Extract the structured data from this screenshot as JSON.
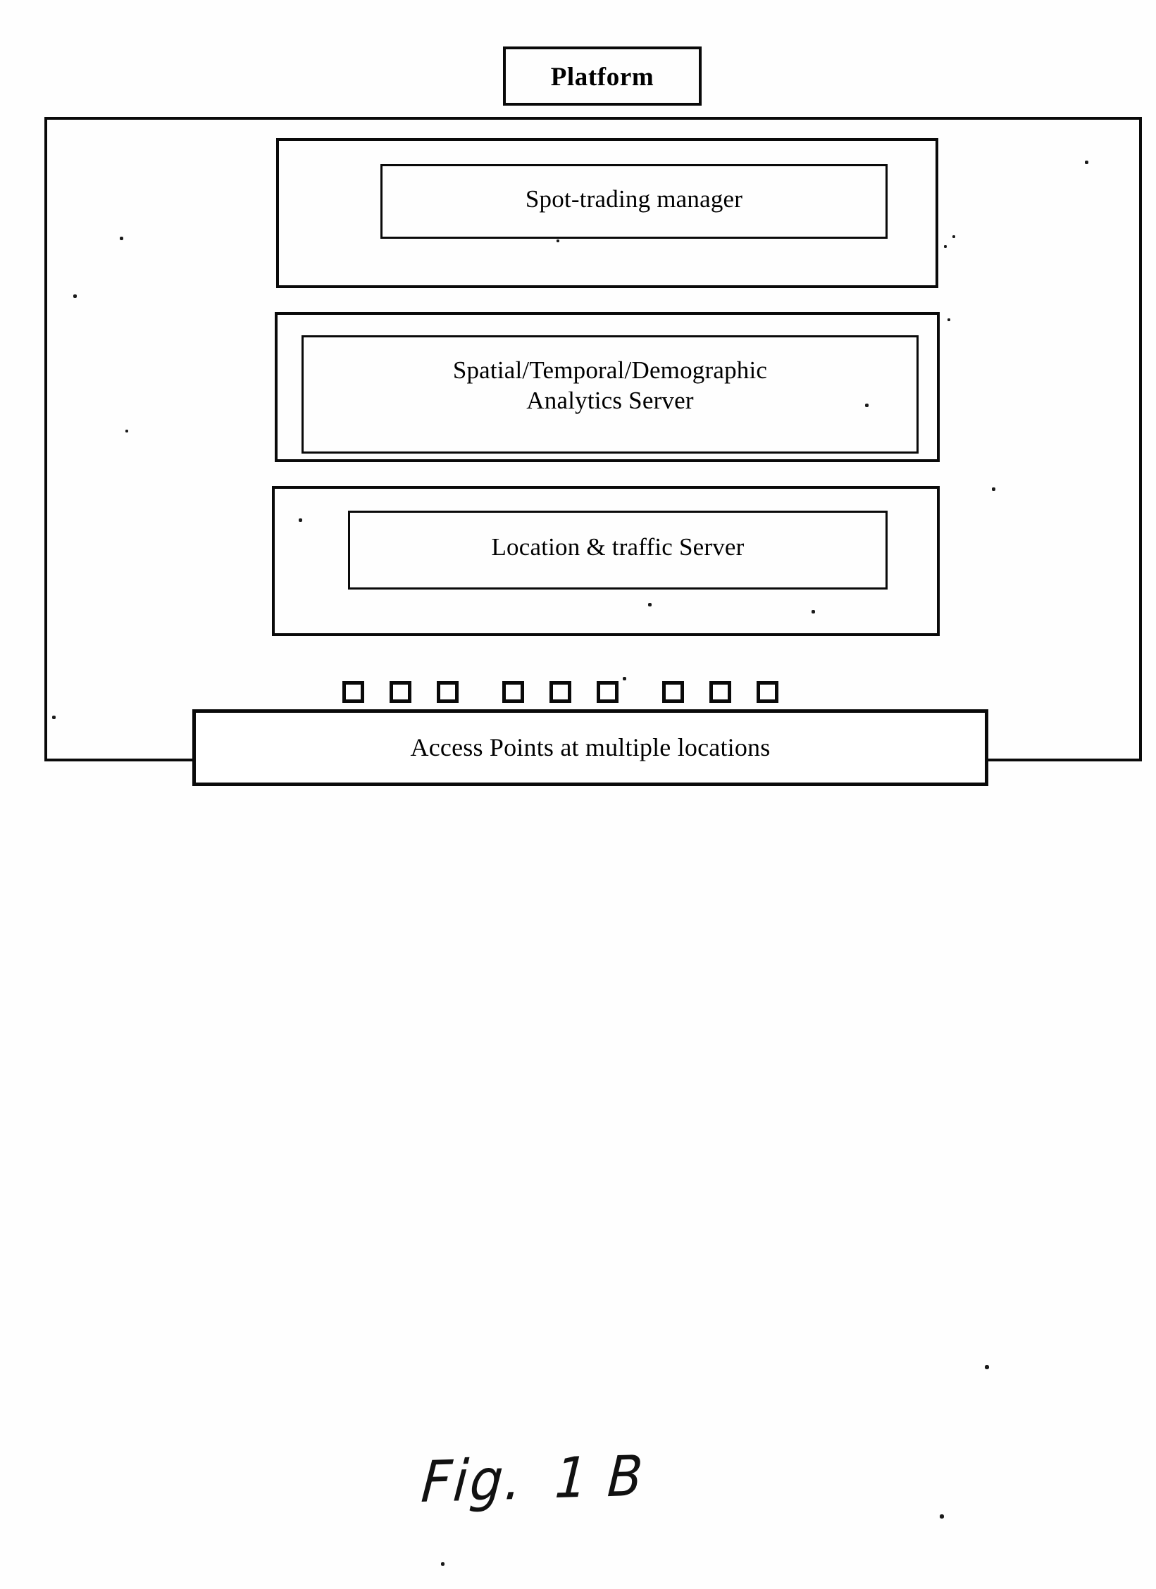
{
  "diagram": {
    "platform_tag": {
      "label": "Platform"
    },
    "modules": [
      {
        "name": "spot-trading-manager",
        "label": "Spot-trading manager"
      },
      {
        "name": "analytics-server",
        "label": "Spatial/Temporal/Demographic\nAnalytics Server"
      },
      {
        "name": "location-traffic-server",
        "label": "Location & traffic Server"
      }
    ],
    "access_points": {
      "bar_label": "Access Points at multiple locations",
      "square_groups": [
        3,
        3,
        3
      ],
      "square_icon_name": "access-point-square-icon"
    }
  },
  "caption": {
    "prefix": "Fig.",
    "number": "1 B"
  },
  "colors": {
    "ink": "#0a0a0a",
    "paper": "#fefefe"
  }
}
